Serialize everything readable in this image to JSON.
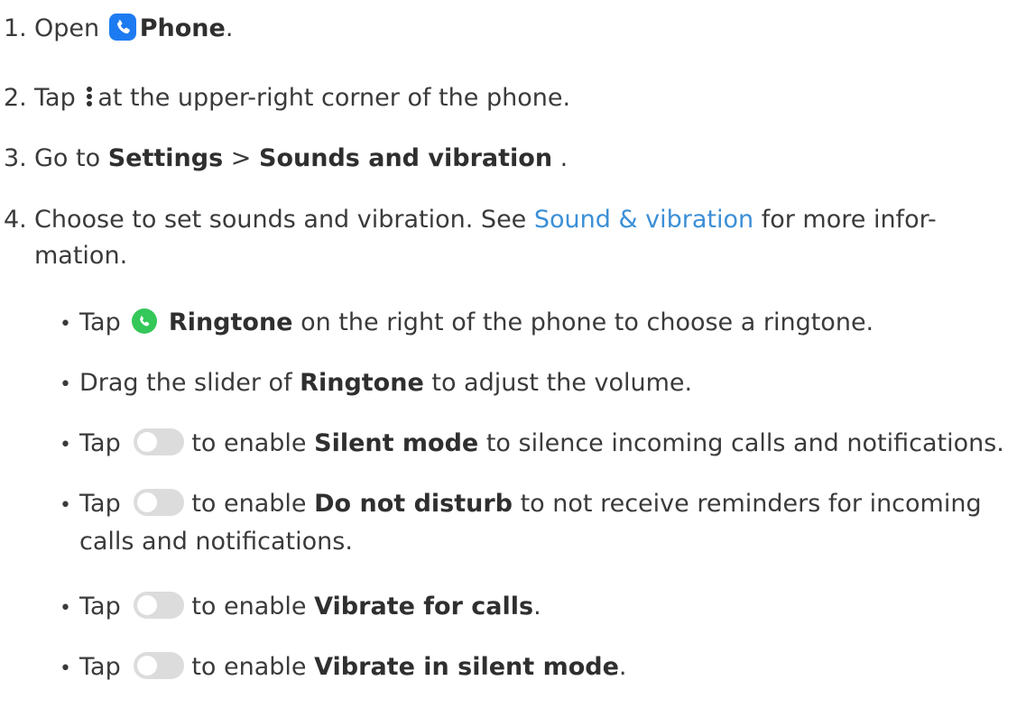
{
  "steps": [
    {
      "num": "1.",
      "before": "Open",
      "bold": "Phone",
      "after": ".",
      "icon": "phone-app-icon"
    },
    {
      "num": "2.",
      "before": "Tap",
      "after": "at the upper-right corner of the phone.",
      "icon": "more-options-icon"
    },
    {
      "num": "3.",
      "before": "Go to",
      "bold1": "Settings",
      "sep": ">",
      "bold2": "Sounds and vibration",
      "after": "."
    },
    {
      "num": "4.",
      "before": "Choose to set sounds and vibration. See",
      "link": "Sound & vibration",
      "after": "for more infor-",
      "cont": "mation."
    }
  ],
  "bullets": [
    {
      "dot": "•",
      "before": "Tap",
      "bold": "Ringtone",
      "after": "on the right of the phone to choose a ringtone.",
      "icon": "ringtone-icon"
    },
    {
      "dot": "•",
      "before": "Drag the slider of",
      "bold": "Ringtone",
      "after": "to adjust the volume."
    },
    {
      "dot": "•",
      "before": "Tap",
      "mid": "to enable",
      "bold": "Silent mode",
      "after": "to silence incoming calls and notifications.",
      "icon": "toggle-icon"
    },
    {
      "dot": "•",
      "before": "Tap",
      "mid": "to enable",
      "bold": "Do not disturb",
      "after": "to not receive reminders for incoming",
      "cont": "calls and notifications.",
      "icon": "toggle-icon"
    },
    {
      "dot": "•",
      "before": "Tap",
      "mid": "to enable",
      "bold": "Vibrate for calls",
      "after": ".",
      "icon": "toggle-icon"
    },
    {
      "dot": "•",
      "before": "Tap",
      "mid": "to enable",
      "bold": "Vibrate in silent mode",
      "after": ".",
      "icon": "toggle-icon"
    }
  ],
  "colors": {
    "text": "#3a3a3a",
    "link": "#3b8fd6",
    "phone_icon": "#1d7bf2",
    "ringtone_icon": "#34c759",
    "toggle_off": "#dcdcdc"
  }
}
